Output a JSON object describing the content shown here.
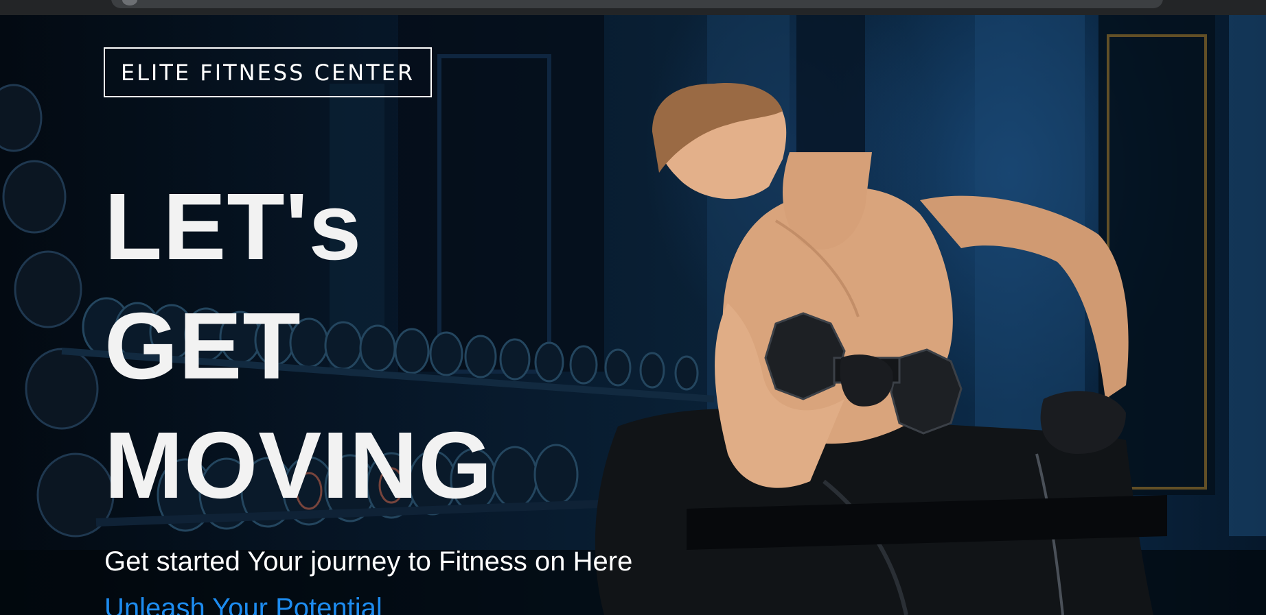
{
  "brand": {
    "name": "ELITE FITNESS CENTER"
  },
  "hero": {
    "headline_lines": [
      "LET's",
      "GET",
      "MOVING"
    ],
    "subtitle": "Get started Your journey to Fitness on Here",
    "cta_link": "Unleash Your Potential",
    "image_alt": "athlete-doing-dumbbell-curl"
  },
  "colors": {
    "headline": "#f2f2f2",
    "link": "#1d8cf0",
    "background": "#0a2238"
  }
}
